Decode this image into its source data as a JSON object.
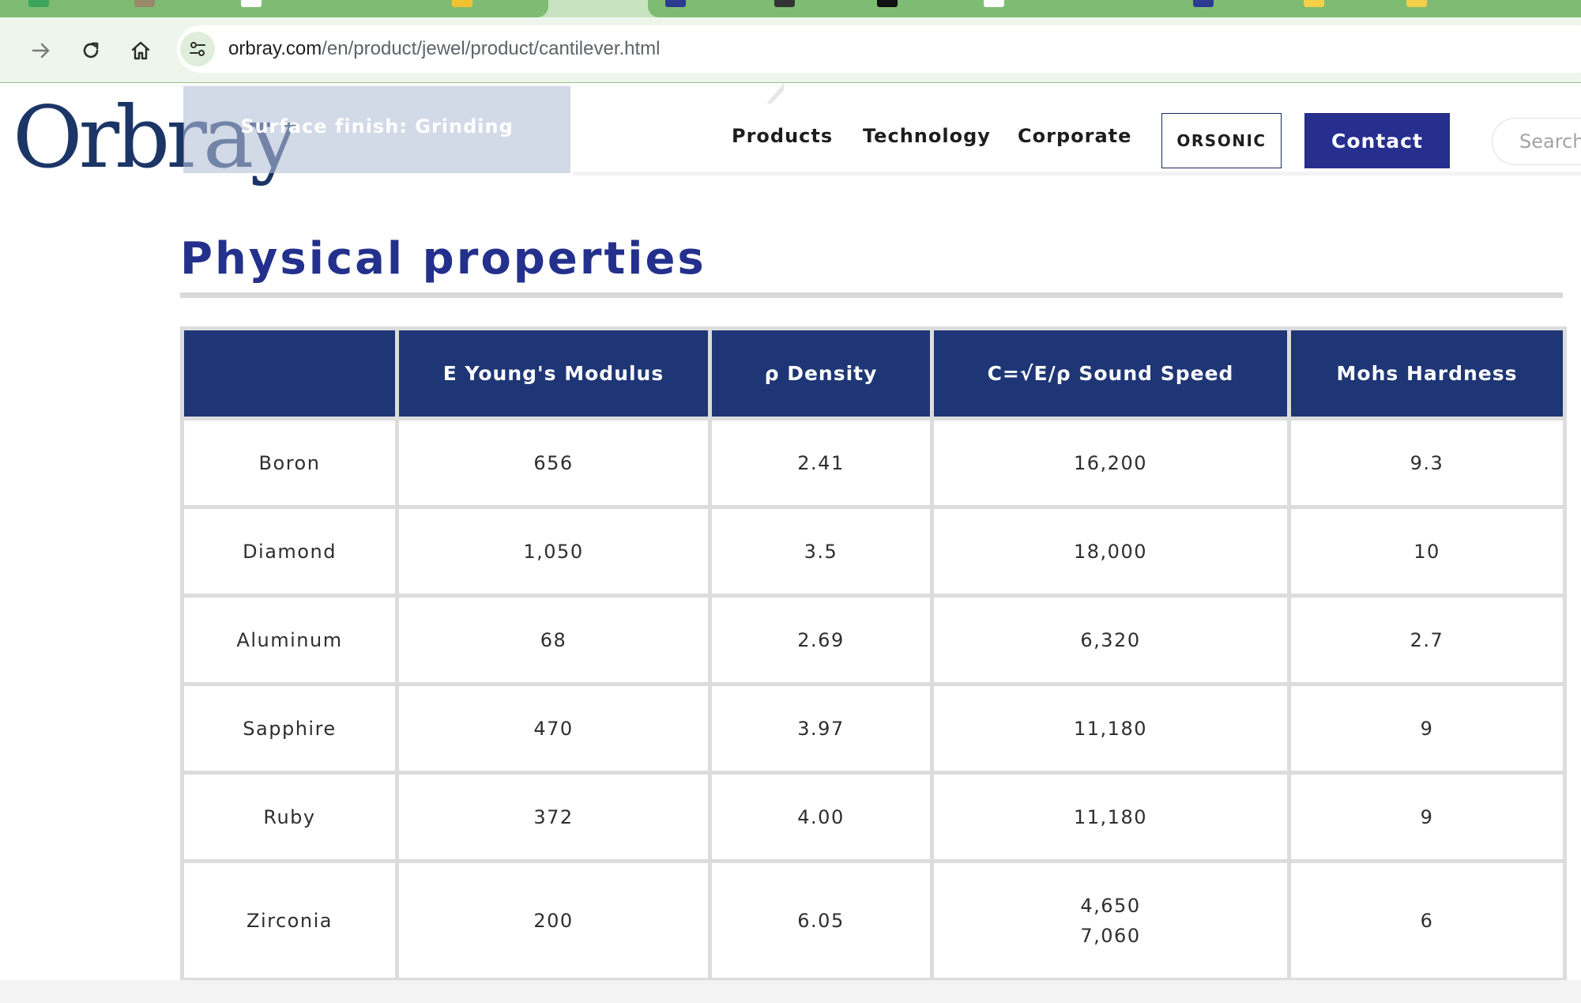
{
  "browser": {
    "address": {
      "host": "orbray.com",
      "path": "/en/product/jewel/product/cantilever.html"
    }
  },
  "header": {
    "logo": "Orbray",
    "overlay_label": "Surface finish: Grinding",
    "nav": [
      "Products",
      "Technology",
      "Corporate"
    ],
    "orsonic_label": "ORSONIC",
    "contact_label": "Contact",
    "search_placeholder": "Search"
  },
  "main": {
    "title": "Physical properties",
    "table": {
      "headers": [
        "",
        "E Young's Modulus",
        "ρ Density",
        "C=√E/ρ Sound Speed",
        "Mohs Hardness"
      ],
      "rows": [
        {
          "material": "Boron",
          "modulus": "656",
          "density": "2.41",
          "sound_speed": [
            "16,200"
          ],
          "hardness": "9.3"
        },
        {
          "material": "Diamond",
          "modulus": "1,050",
          "density": "3.5",
          "sound_speed": [
            "18,000"
          ],
          "hardness": "10"
        },
        {
          "material": "Aluminum",
          "modulus": "68",
          "density": "2.69",
          "sound_speed": [
            "6,320"
          ],
          "hardness": "2.7"
        },
        {
          "material": "Sapphire",
          "modulus": "470",
          "density": "3.97",
          "sound_speed": [
            "11,180"
          ],
          "hardness": "9"
        },
        {
          "material": "Ruby",
          "modulus": "372",
          "density": "4.00",
          "sound_speed": [
            "11,180"
          ],
          "hardness": "9"
        },
        {
          "material": "Zirconia",
          "modulus": "200",
          "density": "6.05",
          "sound_speed": [
            "4,650",
            "7,060"
          ],
          "hardness": "6"
        }
      ]
    }
  },
  "colors": {
    "brand_navy": "#1e3675",
    "title_blue": "#23308c",
    "contact_bg": "#262e8e",
    "chrome_green": "#7ebc73"
  },
  "icons": [
    "forward-arrow-icon",
    "reload-icon",
    "home-icon",
    "site-info-icon"
  ]
}
